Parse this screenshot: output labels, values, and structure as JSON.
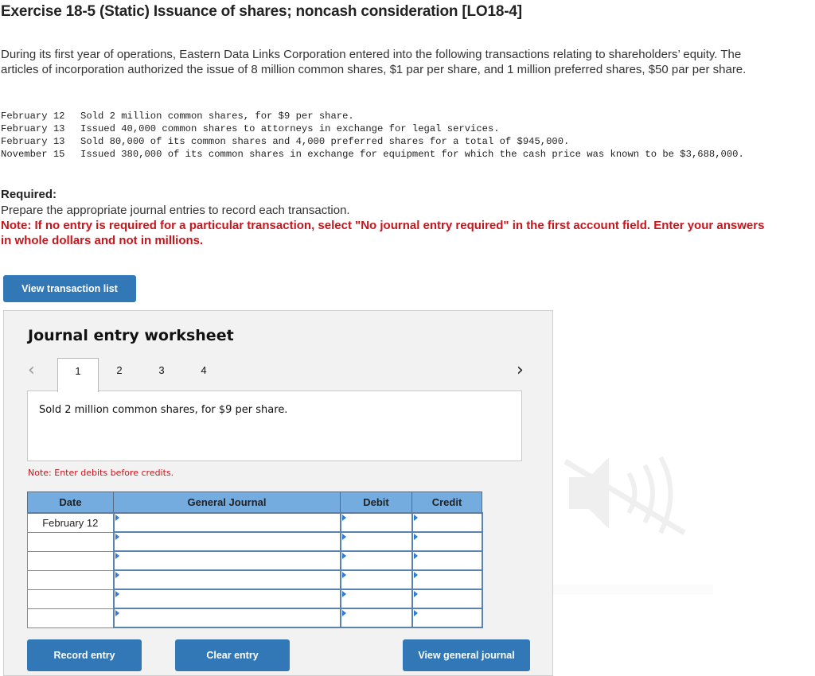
{
  "title": "Exercise 18-5 (Static) Issuance of shares; noncash consideration [LO18-4]",
  "intro": "During its first year of operations, Eastern Data Links Corporation entered into the following transactions relating to shareholders’ equity. The articles of incorporation authorized the issue of 8 million common shares, $1 par per share, and 1 million preferred shares, $50 par per share.",
  "transactions": [
    {
      "date": "February 12",
      "description": "Sold 2 million common shares, for $9 per share."
    },
    {
      "date": "February 13",
      "description": "Issued 40,000 common shares to attorneys in exchange for legal services."
    },
    {
      "date": "February 13",
      "description": "Sold 80,000 of its common shares and 4,000 preferred shares for a total of $945,000."
    },
    {
      "date": "November 15",
      "description": "Issued 380,000 of its common shares in exchange for equipment for which the cash price was known to be $3,688,000."
    }
  ],
  "required": {
    "heading": "Required:",
    "text": "Prepare the appropriate journal entries to record each transaction.",
    "note": "Note: If no entry is required for a particular transaction, select \"No journal entry required\" in the first account field. Enter your answers in whole dollars and not in millions."
  },
  "buttons": {
    "view_transaction_list": "View transaction list",
    "record_entry": "Record entry",
    "clear_entry": "Clear entry",
    "view_general_journal": "View general journal"
  },
  "worksheet": {
    "title": "Journal entry worksheet",
    "prev_icon": "‹",
    "next_icon": "›",
    "tabs": [
      "1",
      "2",
      "3",
      "4"
    ],
    "active_tab": "1",
    "description": "Sold 2 million common shares, for $9 per share.",
    "note": "Note: Enter debits before credits.",
    "table": {
      "headers": [
        "Date",
        "General Journal",
        "Debit",
        "Credit"
      ],
      "rows": [
        {
          "date": "February 12",
          "account": "",
          "debit": "",
          "credit": ""
        },
        {
          "date": "",
          "account": "",
          "debit": "",
          "credit": ""
        },
        {
          "date": "",
          "account": "",
          "debit": "",
          "credit": ""
        },
        {
          "date": "",
          "account": "",
          "debit": "",
          "credit": ""
        },
        {
          "date": "",
          "account": "",
          "debit": "",
          "credit": ""
        },
        {
          "date": "",
          "account": "",
          "debit": "",
          "credit": ""
        }
      ]
    }
  },
  "colors": {
    "button_blue": "#3278b7",
    "header_blue": "#74ace0",
    "note_red": "#c4161c",
    "panel_bg": "#f2f2f2"
  }
}
